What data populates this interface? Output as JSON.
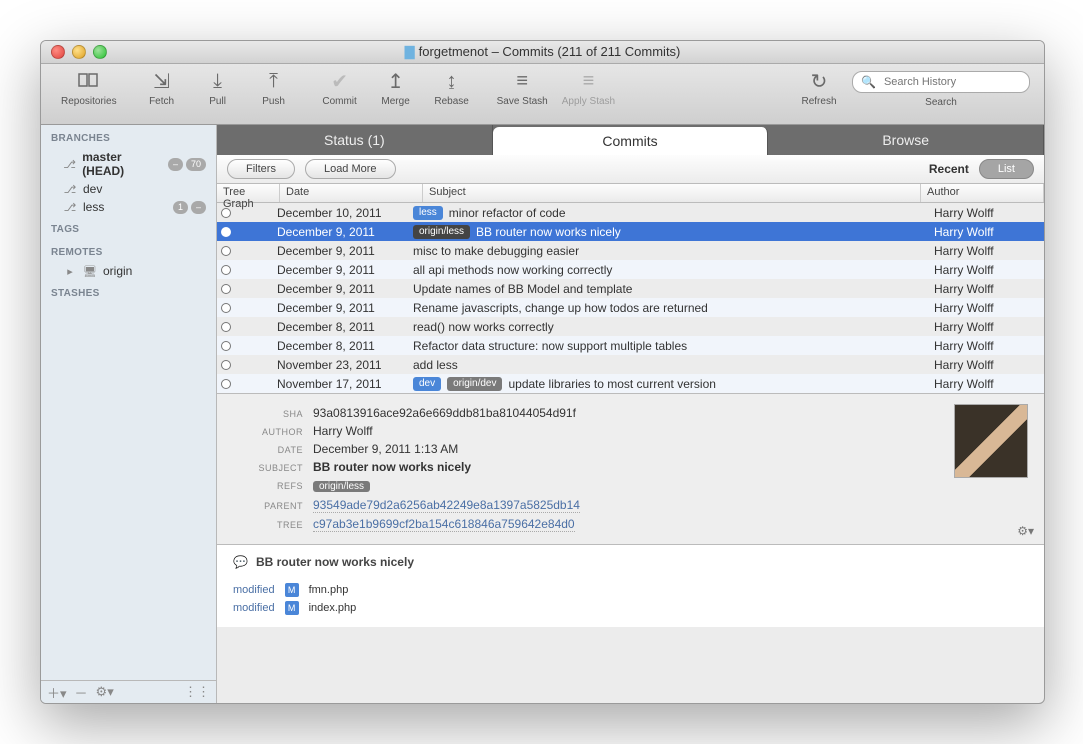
{
  "window": {
    "title": "forgetmenot – Commits (211 of 211 Commits)"
  },
  "toolbar": {
    "repositories": "Repositories",
    "fetch": "Fetch",
    "pull": "Pull",
    "push": "Push",
    "commit": "Commit",
    "merge": "Merge",
    "rebase": "Rebase",
    "save_stash": "Save Stash",
    "apply_stash": "Apply Stash",
    "refresh": "Refresh",
    "search_placeholder": "Search History",
    "search_label": "Search"
  },
  "sidebar": {
    "sections": {
      "branches": "BRANCHES",
      "tags": "TAGS",
      "remotes": "REMOTES",
      "stashes": "STASHES"
    },
    "branches": [
      {
        "name": "master (HEAD)",
        "behind": "–",
        "ahead": "70"
      },
      {
        "name": "dev"
      },
      {
        "name": "less",
        "behind": "1",
        "ahead": "–"
      }
    ],
    "remotes": [
      {
        "name": "origin"
      }
    ]
  },
  "tabs": {
    "status": "Status (1)",
    "commits": "Commits",
    "browse": "Browse"
  },
  "subbar": {
    "filters": "Filters",
    "load_more": "Load More",
    "recent": "Recent",
    "list": "List"
  },
  "columns": {
    "tree": "Tree Graph",
    "date": "Date",
    "subject": "Subject",
    "author": "Author"
  },
  "commits": [
    {
      "date": "December 10, 2011",
      "tags": [
        {
          "text": "less",
          "style": "blue"
        }
      ],
      "subject": "minor refactor of code",
      "author": "Harry Wolff"
    },
    {
      "date": "December 9, 2011",
      "tags": [
        {
          "text": "origin/less",
          "style": "gray"
        }
      ],
      "subject": "BB router now works nicely",
      "author": "Harry Wolff",
      "selected": true
    },
    {
      "date": "December 9, 2011",
      "tags": [],
      "subject": "misc to make debugging easier",
      "author": "Harry Wolff"
    },
    {
      "date": "December 9, 2011",
      "tags": [],
      "subject": "all api methods now working correctly",
      "author": "Harry Wolff"
    },
    {
      "date": "December 9, 2011",
      "tags": [],
      "subject": "Update names of BB Model and template",
      "author": "Harry Wolff"
    },
    {
      "date": "December 9, 2011",
      "tags": [],
      "subject": "Rename javascripts, change up how todos are returned",
      "author": "Harry Wolff"
    },
    {
      "date": "December 8, 2011",
      "tags": [],
      "subject": "read() now works correctly",
      "author": "Harry Wolff"
    },
    {
      "date": "December 8, 2011",
      "tags": [],
      "subject": "Refactor data structure: now support multiple tables",
      "author": "Harry Wolff"
    },
    {
      "date": "November 23, 2011",
      "tags": [],
      "subject": "add less",
      "author": "Harry Wolff"
    },
    {
      "date": "November 17, 2011",
      "tags": [
        {
          "text": "dev",
          "style": "blue"
        },
        {
          "text": "origin/dev",
          "style": "gray"
        }
      ],
      "subject": "update libraries to most current version",
      "author": "Harry Wolff"
    }
  ],
  "detail": {
    "labels": {
      "sha": "SHA",
      "author": "AUTHOR",
      "date": "DATE",
      "subject": "SUBJECT",
      "refs": "REFS",
      "parent": "PARENT",
      "tree": "TREE"
    },
    "sha": "93a0813916ace92a6e669ddb81ba81044054d91f",
    "author": "Harry Wolff",
    "date": "December 9, 2011 1:13 AM",
    "subject": "BB router now works nicely",
    "refs": "origin/less",
    "parent": "93549ade79d2a6256ab42249e8a1397a5825db14",
    "tree": "c97ab3e1b9699cf2ba154c618846a759642e84d0"
  },
  "files": {
    "commit_message": "BB router now works nicely",
    "modified_label": "modified",
    "m_badge": "M",
    "items": [
      "fmn.php",
      "index.php"
    ]
  }
}
